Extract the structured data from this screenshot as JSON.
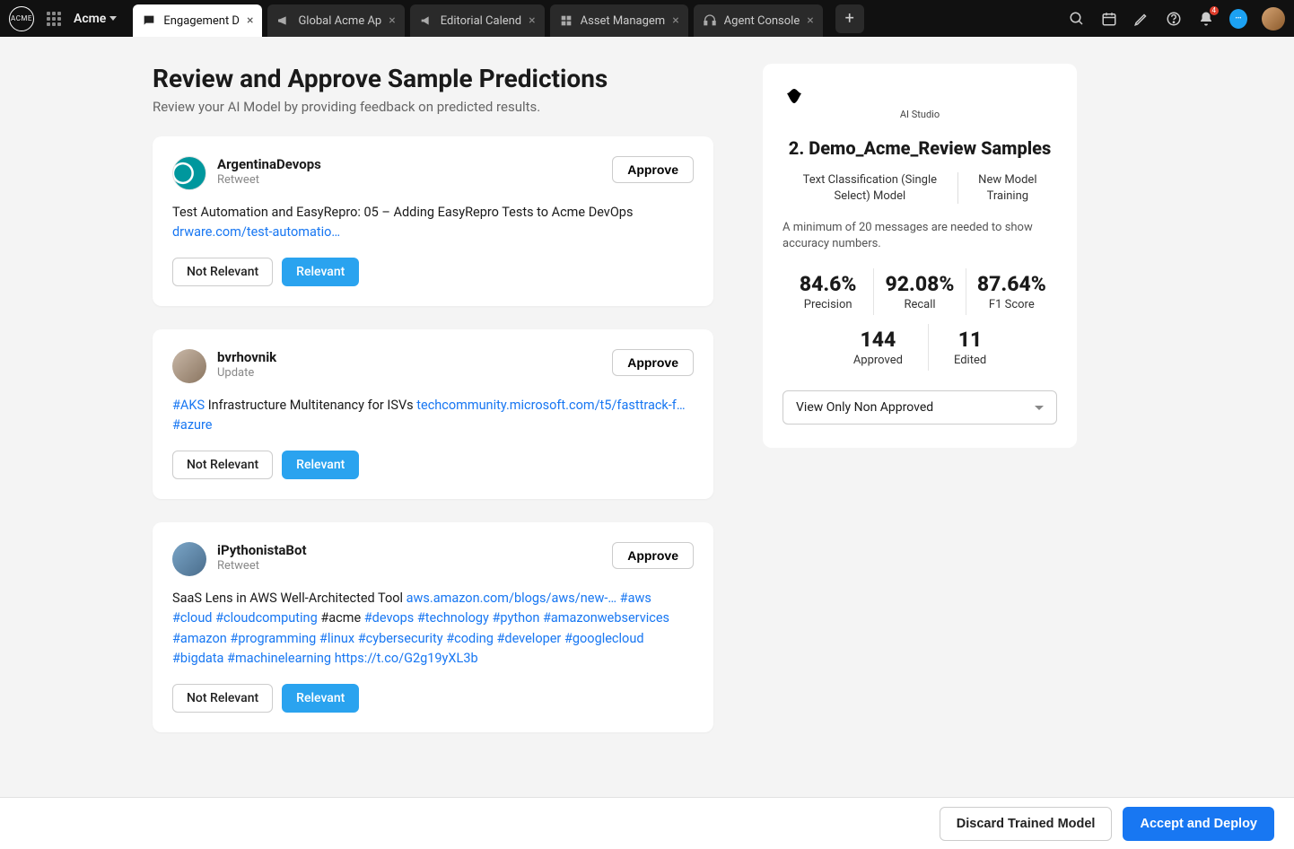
{
  "workspace": {
    "name": "Acme",
    "logo_text": "ACME"
  },
  "tabs": [
    {
      "label": "Engagement D",
      "active": true,
      "icon": "chat"
    },
    {
      "label": "Global Acme Ap",
      "active": false,
      "icon": "megaphone"
    },
    {
      "label": "Editorial Calend",
      "active": false,
      "icon": "announce"
    },
    {
      "label": "Asset Managem",
      "active": false,
      "icon": "widget"
    },
    {
      "label": "Agent Console",
      "active": false,
      "icon": "headset"
    }
  ],
  "topbar_icons": {
    "notification_count": "4"
  },
  "page": {
    "title": "Review and Approve Sample Predictions",
    "subtitle": "Review your AI Model by providing feedback on predicted results."
  },
  "labels": {
    "approve": "Approve",
    "not_relevant": "Not Relevant",
    "relevant": "Relevant"
  },
  "predictions": [
    {
      "username": "ArgentinaDevops",
      "subline": "Retweet",
      "avatar_class": "av-arduino",
      "body_parts": [
        {
          "t": "text",
          "v": "Test Automation and EasyRepro: 05 – Adding EasyRepro Tests to "
        },
        {
          "t": "text",
          "v": "Acme"
        },
        {
          "t": "text",
          "v": " DevOps "
        },
        {
          "t": "link",
          "v": "drware.com/test-automatio…"
        }
      ]
    },
    {
      "username": "bvrhovnik",
      "subline": "Update",
      "avatar_class": "av-person",
      "body_parts": [
        {
          "t": "link",
          "v": "#AKS"
        },
        {
          "t": "text",
          "v": " Infrastructure Multitenancy for ISVs "
        },
        {
          "t": "link",
          "v": "techcommunity.microsoft.com/t5/fasttrack-f…"
        },
        {
          "t": "text",
          "v": " "
        },
        {
          "t": "link",
          "v": "#azure"
        }
      ]
    },
    {
      "username": "iPythonistaBot",
      "subline": "Retweet",
      "avatar_class": "av-bot",
      "body_parts": [
        {
          "t": "text",
          "v": "SaaS Lens in AWS Well-Architected Tool "
        },
        {
          "t": "link",
          "v": "aws.amazon.com/blogs/aws/new-…"
        },
        {
          "t": "text",
          "v": " "
        },
        {
          "t": "link",
          "v": "#aws"
        },
        {
          "t": "text",
          "v": " "
        },
        {
          "t": "link",
          "v": "#cloud"
        },
        {
          "t": "text",
          "v": " "
        },
        {
          "t": "link",
          "v": "#cloudcomputing"
        },
        {
          "t": "text",
          "v": " "
        },
        {
          "t": "text",
          "v": "#acme"
        },
        {
          "t": "text",
          "v": " "
        },
        {
          "t": "link",
          "v": "#devops"
        },
        {
          "t": "text",
          "v": " "
        },
        {
          "t": "link",
          "v": "#technology"
        },
        {
          "t": "text",
          "v": " "
        },
        {
          "t": "link",
          "v": "#python"
        },
        {
          "t": "text",
          "v": " "
        },
        {
          "t": "link",
          "v": "#amazonwebservices"
        },
        {
          "t": "text",
          "v": " "
        },
        {
          "t": "link",
          "v": "#amazon"
        },
        {
          "t": "text",
          "v": " "
        },
        {
          "t": "link",
          "v": "#programming"
        },
        {
          "t": "text",
          "v": " "
        },
        {
          "t": "link",
          "v": "#linux"
        },
        {
          "t": "text",
          "v": " "
        },
        {
          "t": "link",
          "v": "#cybersecurity"
        },
        {
          "t": "text",
          "v": " "
        },
        {
          "t": "link",
          "v": "#coding"
        },
        {
          "t": "text",
          "v": " "
        },
        {
          "t": "link",
          "v": "#developer"
        },
        {
          "t": "text",
          "v": " "
        },
        {
          "t": "link",
          "v": "#googlecloud"
        },
        {
          "t": "text",
          "v": " "
        },
        {
          "t": "link",
          "v": "#bigdata"
        },
        {
          "t": "text",
          "v": " "
        },
        {
          "t": "link",
          "v": "#machinelearning"
        },
        {
          "t": "text",
          "v": " "
        },
        {
          "t": "link",
          "v": "https://t.co/G2g19yXL3b"
        }
      ]
    }
  ],
  "panel": {
    "brand": "AI Studio",
    "title": "2. Demo_Acme_Review Samples",
    "meta_left": "Text Classification (Single Select) Model",
    "meta_right": "New Model Training",
    "note": "A minimum of 20 messages are needed to show accuracy numbers.",
    "stats": {
      "precision": {
        "value": "84.6%",
        "label": "Precision"
      },
      "recall": {
        "value": "92.08%",
        "label": "Recall"
      },
      "f1": {
        "value": "87.64%",
        "label": "F1 Score"
      },
      "approved": {
        "value": "144",
        "label": "Approved"
      },
      "edited": {
        "value": "11",
        "label": "Edited"
      }
    },
    "filter": "View Only Non Approved"
  },
  "footer": {
    "discard": "Discard Trained Model",
    "deploy": "Accept and Deploy"
  }
}
